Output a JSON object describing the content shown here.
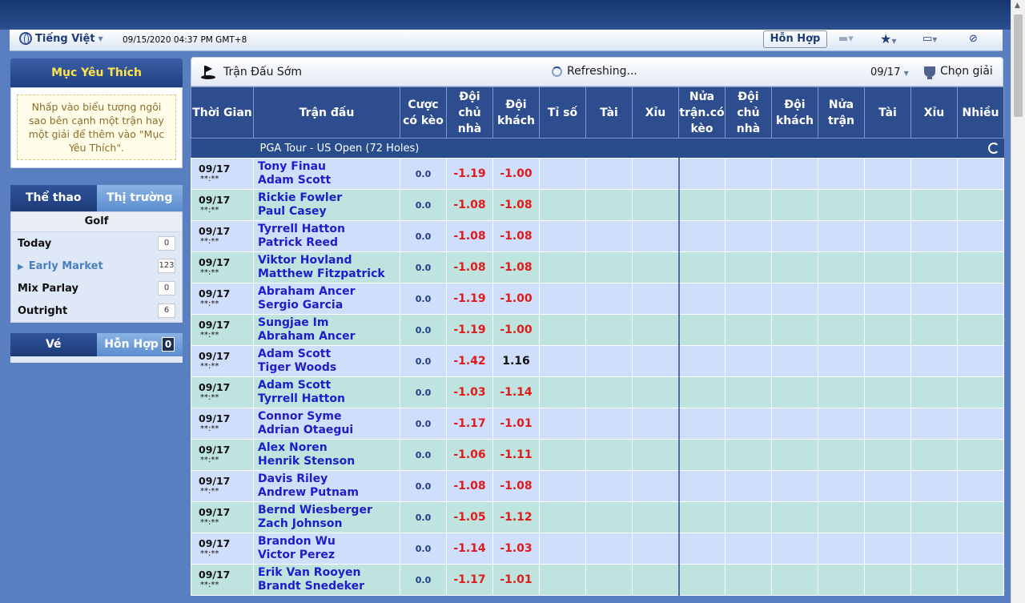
{
  "toolbar": {
    "language": "Tiếng Việt",
    "datetime": "09/15/2020 04:37 PM GMT+8",
    "mixed_button": "Hỗn Hợp"
  },
  "sidebar": {
    "favorites_title": "Mục Yêu Thích",
    "favorites_note": "Nhấp vào biểu tượng ngôi sao bên cạnh một trận hay một giải để thêm vào \"Mục Yêu Thích\".",
    "tab_sports": "Thể thao",
    "tab_market": "Thị trường",
    "sport_title": "Golf",
    "markets": [
      {
        "label": "Today",
        "count": "0"
      },
      {
        "label": "Early Market",
        "count": "123"
      },
      {
        "label": "Mix Parlay",
        "count": "0"
      },
      {
        "label": "Outright",
        "count": "6"
      }
    ],
    "tab_ticket": "Vé",
    "tab_mixed": "Hỗn Hợp",
    "mixed_count": "0"
  },
  "main": {
    "title": "Trận Đấu Sớm",
    "refreshing": "Refreshing...",
    "date": "09/17",
    "choose_league": "Chọn giải"
  },
  "table": {
    "headers": {
      "time": "Thời Gian",
      "match": "Trận đấu",
      "handicap_a": "Cược",
      "handicap_b": "có kèo",
      "home_a": "Đội chủ",
      "home_b": "nhà",
      "away_a": "Đội",
      "away_b": "khách",
      "score": "Tỉ số",
      "over": "Tài",
      "under": "Xỉu",
      "half_hdp_a": "Nửa",
      "half_hdp_b": "trận.có",
      "half_hdp_c": "kèo",
      "h_home_a": "Đội chủ",
      "h_home_b": "nhà",
      "h_away_a": "Đội",
      "h_away_b": "khách",
      "half_a": "Nửa",
      "half_b": "trận",
      "h_over": "Tài",
      "h_under": "Xỉu",
      "more": "Nhiều"
    },
    "league": "PGA Tour - US Open (72 Holes)",
    "matches": [
      {
        "date": "09/17",
        "time": "**:**",
        "home": "Tony Finau",
        "away": "Adam Scott",
        "hdp": "0.0",
        "home_odds": "-1.19",
        "away_odds": "-1.00"
      },
      {
        "date": "09/17",
        "time": "**:**",
        "home": "Rickie Fowler",
        "away": "Paul Casey",
        "hdp": "0.0",
        "home_odds": "-1.08",
        "away_odds": "-1.08"
      },
      {
        "date": "09/17",
        "time": "**:**",
        "home": "Tyrrell Hatton",
        "away": "Patrick Reed",
        "hdp": "0.0",
        "home_odds": "-1.08",
        "away_odds": "-1.08"
      },
      {
        "date": "09/17",
        "time": "**:**",
        "home": "Viktor Hovland",
        "away": "Matthew Fitzpatrick",
        "hdp": "0.0",
        "home_odds": "-1.08",
        "away_odds": "-1.08"
      },
      {
        "date": "09/17",
        "time": "**:**",
        "home": "Abraham Ancer",
        "away": "Sergio Garcia",
        "hdp": "0.0",
        "home_odds": "-1.19",
        "away_odds": "-1.00"
      },
      {
        "date": "09/17",
        "time": "**:**",
        "home": "Sungjae Im",
        "away": "Abraham Ancer",
        "hdp": "0.0",
        "home_odds": "-1.19",
        "away_odds": "-1.00"
      },
      {
        "date": "09/17",
        "time": "**:**",
        "home": "Adam Scott",
        "away": "Tiger Woods",
        "hdp": "0.0",
        "home_odds": "-1.42",
        "away_odds": "1.16"
      },
      {
        "date": "09/17",
        "time": "**:**",
        "home": "Adam Scott",
        "away": "Tyrrell Hatton",
        "hdp": "0.0",
        "home_odds": "-1.03",
        "away_odds": "-1.14"
      },
      {
        "date": "09/17",
        "time": "**:**",
        "home": "Connor Syme",
        "away": "Adrian Otaegui",
        "hdp": "0.0",
        "home_odds": "-1.17",
        "away_odds": "-1.01"
      },
      {
        "date": "09/17",
        "time": "**:**",
        "home": "Alex Noren",
        "away": "Henrik Stenson",
        "hdp": "0.0",
        "home_odds": "-1.06",
        "away_odds": "-1.11"
      },
      {
        "date": "09/17",
        "time": "**:**",
        "home": "Davis Riley",
        "away": "Andrew Putnam",
        "hdp": "0.0",
        "home_odds": "-1.08",
        "away_odds": "-1.08"
      },
      {
        "date": "09/17",
        "time": "**:**",
        "home": "Bernd Wiesberger",
        "away": "Zach Johnson",
        "hdp": "0.0",
        "home_odds": "-1.05",
        "away_odds": "-1.12"
      },
      {
        "date": "09/17",
        "time": "**:**",
        "home": "Brandon Wu",
        "away": "Victor Perez",
        "hdp": "0.0",
        "home_odds": "-1.14",
        "away_odds": "-1.03"
      },
      {
        "date": "09/17",
        "time": "**:**",
        "home": "Erik Van Rooyen",
        "away": "Brandt Snedeker",
        "hdp": "0.0",
        "home_odds": "-1.17",
        "away_odds": "-1.01"
      }
    ]
  }
}
